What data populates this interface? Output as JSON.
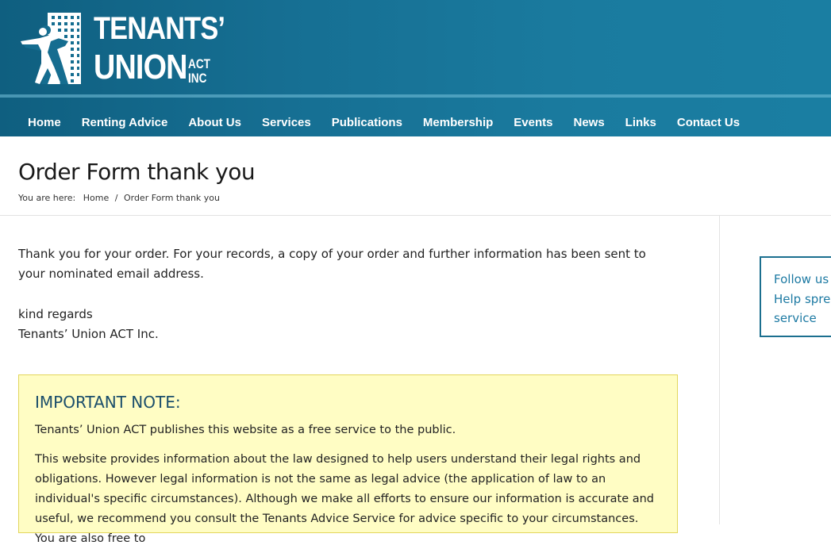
{
  "header": {
    "brand_line1": "TENANTS’",
    "brand_line2": "UNION",
    "brand_act": "ACT",
    "brand_inc": "INC",
    "logo_icon": "person-building-icon",
    "colors": {
      "header_bg": "#166f93",
      "nav_text": "#ffffff"
    }
  },
  "nav": {
    "items": [
      {
        "label": "Home"
      },
      {
        "label": "Renting Advice"
      },
      {
        "label": "About Us"
      },
      {
        "label": "Services"
      },
      {
        "label": "Publications"
      },
      {
        "label": "Membership"
      },
      {
        "label": "Events"
      },
      {
        "label": "News"
      },
      {
        "label": "Links"
      },
      {
        "label": "Contact Us"
      }
    ]
  },
  "page": {
    "title": "Order Form thank you",
    "breadcrumb": {
      "prefix": "You are here:",
      "home": "Home",
      "separator": "/",
      "current": "Order Form thank you"
    }
  },
  "content": {
    "thanks": "Thank you for your order. For your records, a copy of your order and further information has been sent to your nominated email address.",
    "regards": "kind regards",
    "signature": "Tenants’ Union ACT Inc."
  },
  "note": {
    "title": "IMPORTANT NOTE:",
    "para1": "Tenants’ Union ACT publishes this website as a free service to the public.",
    "para2": "This website provides information about the law designed to help users understand their legal rights and obligations. However legal information is not the same as legal advice (the application of law to an individual's specific circumstances). Although we make all efforts to ensure our information is accurate and useful, we recommend you consult the Tenants Advice Service for advice specific to your circumstances. You are also free to",
    "colors": {
      "bg": "#fffdc4",
      "border": "#e2d65c",
      "title": "#1b4e6b"
    }
  },
  "widget": {
    "line1": "Follow us o",
    "line2": "Help sprea",
    "line3": "service",
    "colors": {
      "border": "#1b6f8f",
      "text": "#1d7aa3"
    }
  }
}
